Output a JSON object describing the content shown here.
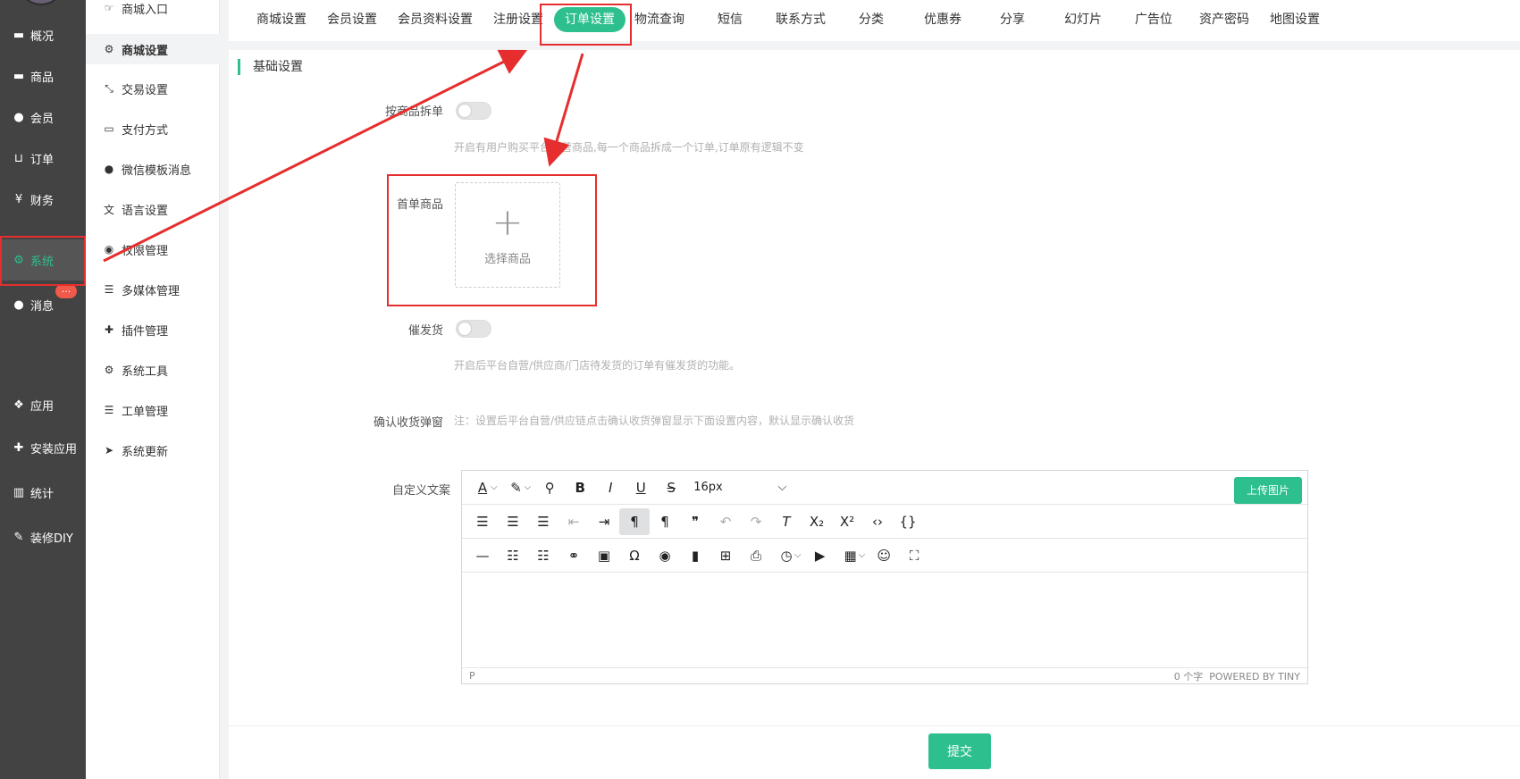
{
  "nav": {
    "items": [
      {
        "label": "概况",
        "icon": "dashboard-icon"
      },
      {
        "label": "商品",
        "icon": "box-icon"
      },
      {
        "label": "会员",
        "icon": "users-icon"
      },
      {
        "label": "订单",
        "icon": "cart-icon"
      },
      {
        "label": "财务",
        "icon": "yen-icon"
      },
      {
        "label": "系统",
        "icon": "gears-icon"
      },
      {
        "label": "消息",
        "icon": "chat-icon"
      },
      {
        "label": "应用",
        "icon": "cubes-icon"
      },
      {
        "label": "安装应用",
        "icon": "puzzle-icon"
      },
      {
        "label": "统计",
        "icon": "bar-chart-icon"
      },
      {
        "label": "装修DIY",
        "icon": "hammer-icon"
      }
    ],
    "badge": "..."
  },
  "submenu": {
    "items": [
      {
        "label": "商城入口",
        "icon": "hand-point-icon"
      },
      {
        "label": "商城设置",
        "icon": "gear-icon"
      },
      {
        "label": "交易设置",
        "icon": "exchange-icon"
      },
      {
        "label": "支付方式",
        "icon": "credit-card-icon"
      },
      {
        "label": "微信模板消息",
        "icon": "wechat-icon"
      },
      {
        "label": "语言设置",
        "icon": "language-icon"
      },
      {
        "label": "权限管理",
        "icon": "gamepad-icon"
      },
      {
        "label": "多媒体管理",
        "icon": "list-icon"
      },
      {
        "label": "插件管理",
        "icon": "puzzle-icon"
      },
      {
        "label": "系统工具",
        "icon": "gear-icon"
      },
      {
        "label": "工单管理",
        "icon": "list-icon"
      },
      {
        "label": "系统更新",
        "icon": "paper-plane-icon"
      }
    ]
  },
  "tabs": [
    "商城设置",
    "会员设置",
    "会员资料设置",
    "注册设置",
    "订单设置",
    "物流查询",
    "短信",
    "联系方式",
    "分类",
    "优惠券",
    "分享",
    "幻灯片",
    "广告位",
    "资产密码",
    "地图设置"
  ],
  "main": {
    "section_title": "基础设置",
    "split_label": "按商品拆单",
    "split_hint": "开启有用户购买平台自营商品,每一个商品拆成一个订单,订单原有逻辑不变",
    "first_goods_label": "首单商品",
    "select_goods": "选择商品",
    "urge_label": "催发货",
    "urge_hint": "开启后平台自营/供应商/门店待发货的订单有催发货的功能。",
    "confirm_label": "确认收货弹窗",
    "confirm_hint": "注：设置后平台自营/供应链点击确认收货弹窗显示下面设置内容，默认显示确认收货",
    "custom_text_label": "自定义文案"
  },
  "editor": {
    "font_size": "16px",
    "upload_label": "上传图片",
    "status_path": "P",
    "word_count": "0 个字",
    "powered": "POWERED BY TINY"
  },
  "footer": {
    "submit": "提交"
  },
  "colors": {
    "accent": "#2ebf8f",
    "nav_bg": "#434343",
    "annotation": "#e62e2e"
  }
}
